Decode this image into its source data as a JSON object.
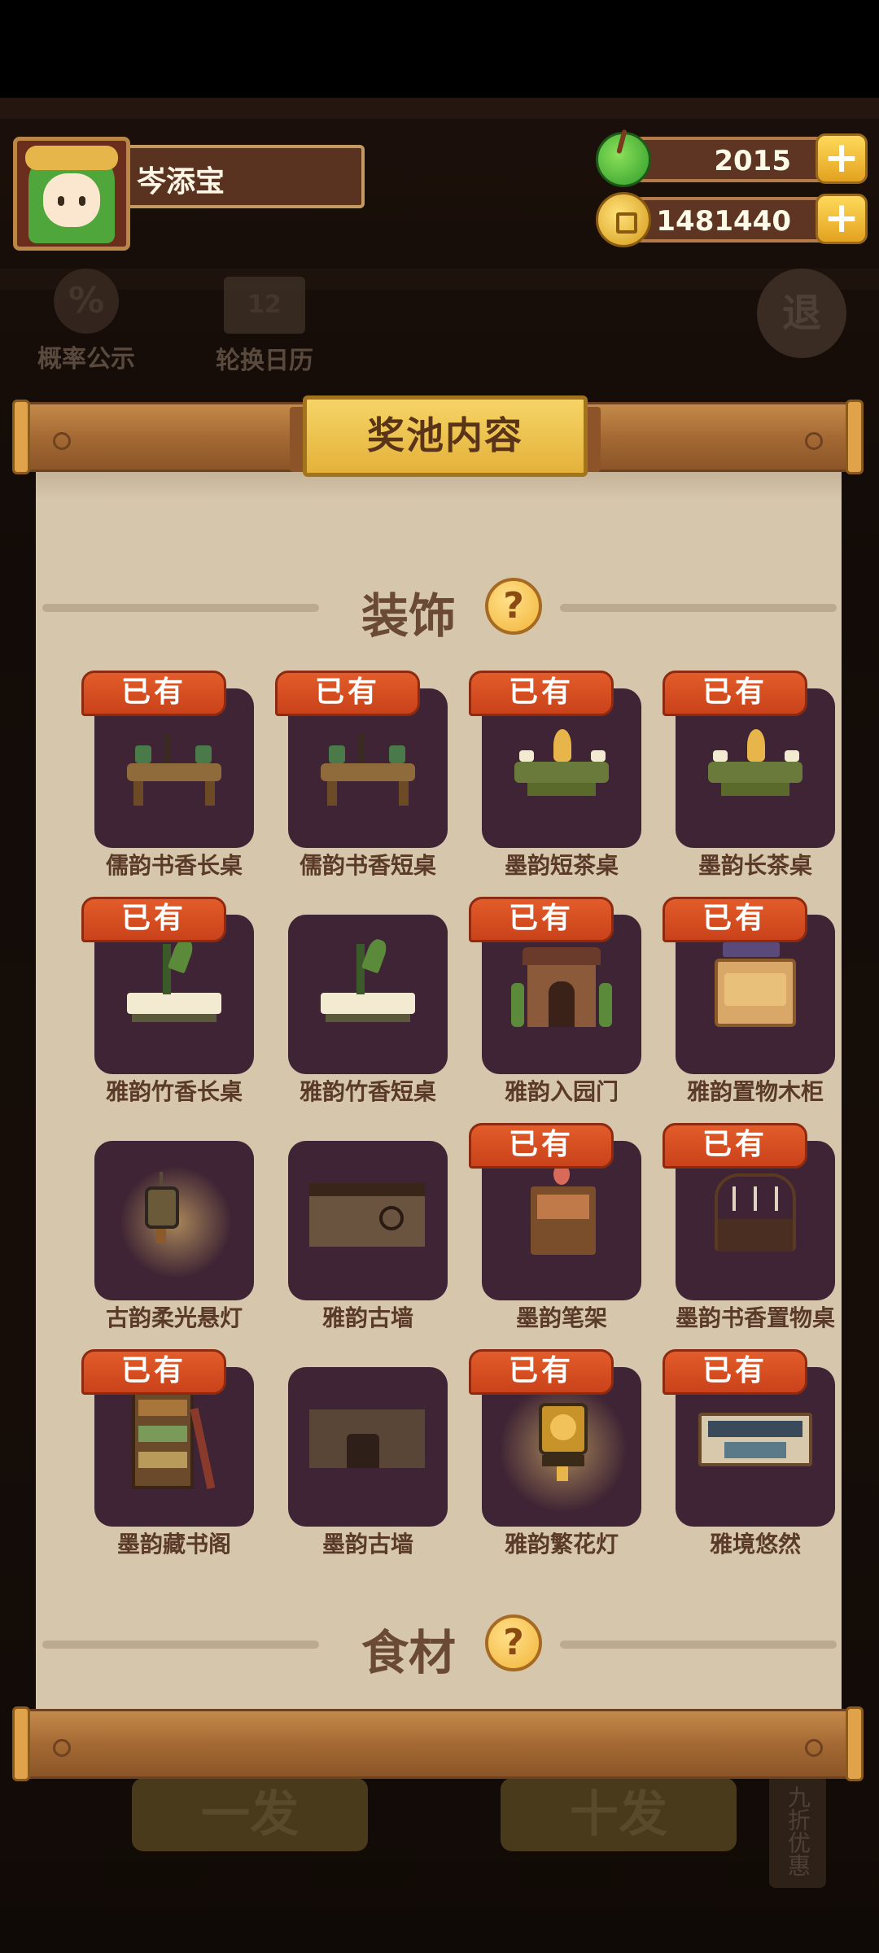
{
  "player": {
    "name": "岑添宝"
  },
  "resources": {
    "jade": "2015",
    "coins": "1481440",
    "add": "+"
  },
  "background": {
    "shortcut_probability": "概率公示",
    "shortcut_calendar": "轮换日历",
    "exit": "退",
    "draw_one": "一发",
    "draw_ten": "十发",
    "discount_tag": "九折优惠"
  },
  "panel": {
    "title": "奖池内容",
    "section_decor": "装饰",
    "section_food": "食材",
    "help": "?",
    "owned_label": "已有"
  },
  "items": [
    {
      "name": "儒韵书香长桌",
      "owned": true
    },
    {
      "name": "儒韵书香短桌",
      "owned": true
    },
    {
      "name": "墨韵短茶桌",
      "owned": true
    },
    {
      "name": "墨韵长茶桌",
      "owned": true
    },
    {
      "name": "雅韵竹香长桌",
      "owned": true
    },
    {
      "name": "雅韵竹香短桌",
      "owned": false
    },
    {
      "name": "雅韵入园门",
      "owned": true
    },
    {
      "name": "雅韵置物木柜",
      "owned": true
    },
    {
      "name": "古韵柔光悬灯",
      "owned": false
    },
    {
      "name": "雅韵古墙",
      "owned": false
    },
    {
      "name": "墨韵笔架",
      "owned": true
    },
    {
      "name": "墨韵书香置物桌",
      "owned": true
    },
    {
      "name": "墨韵藏书阁",
      "owned": true
    },
    {
      "name": "墨韵古墙",
      "owned": false
    },
    {
      "name": "雅韵繁花灯",
      "owned": true
    },
    {
      "name": "雅境悠然",
      "owned": true
    }
  ],
  "colors": {
    "owned_badge": "#d44d20",
    "tile": "#3e2434",
    "parchment": "#d6c6ac",
    "banner": "#f0c54e"
  }
}
